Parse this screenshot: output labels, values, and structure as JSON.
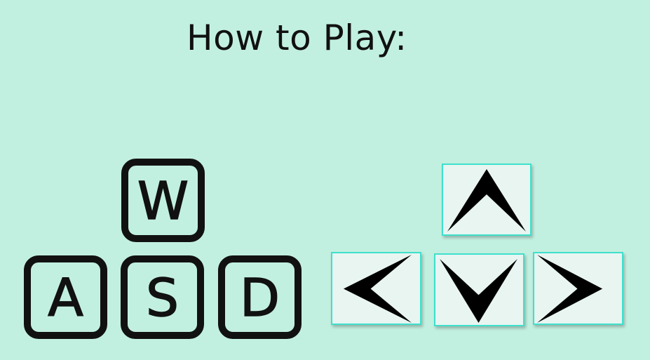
{
  "title": "How to Play:",
  "colors": {
    "background": "#c2f0e0",
    "key_outline": "#111111",
    "arrow_key_fill": "#e8f5f1",
    "arrow_key_border": "#3fe0cc"
  },
  "wasd_keys": [
    {
      "letter": "W",
      "icon": "w-key-icon"
    },
    {
      "letter": "A",
      "icon": "a-key-icon"
    },
    {
      "letter": "S",
      "icon": "s-key-icon"
    },
    {
      "letter": "D",
      "icon": "d-key-icon"
    }
  ],
  "arrow_keys": [
    {
      "direction": "up",
      "icon": "arrow-up-icon"
    },
    {
      "direction": "left",
      "icon": "arrow-left-icon"
    },
    {
      "direction": "down",
      "icon": "arrow-down-icon"
    },
    {
      "direction": "right",
      "icon": "arrow-right-icon"
    }
  ]
}
